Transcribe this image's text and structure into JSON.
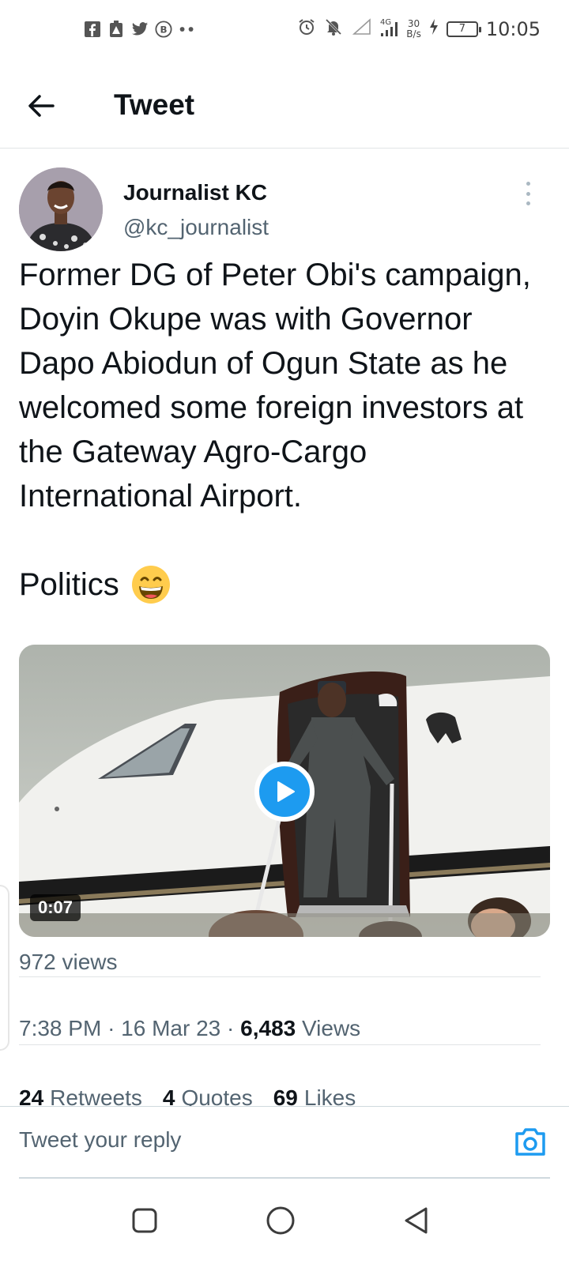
{
  "status_bar": {
    "time": "10:05",
    "net_speed_value": "30",
    "net_speed_unit": "B/s",
    "network": "4G",
    "battery": "7",
    "left_icons": [
      "facebook-icon",
      "alert-app-icon",
      "twitter-icon",
      "b-circle-icon",
      "more-notifications-icon"
    ],
    "right_icons": [
      "alarm-icon",
      "mute-icon",
      "signal-icon",
      "charging-icon"
    ]
  },
  "header": {
    "title": "Tweet",
    "back_icon": "arrow-left-icon"
  },
  "tweet": {
    "author_name": "Journalist KC",
    "author_handle": "@kc_journalist",
    "text": "Former DG of Peter Obi's campaign, Doyin Okupe was with Governor Dapo Abiodun of Ogun State as he welcomed some foreign investors at the Gateway Agro-Cargo International Airport.",
    "text_second": "Politics",
    "emoji": "grinning-face-icon",
    "video_duration": "0:07",
    "video_views": "972 views",
    "time": "7:38 PM",
    "date": "16 Mar 23",
    "separator": "·",
    "view_count": "6,483",
    "views_label": "Views",
    "retweets_count": "24",
    "retweets_label": "Retweets",
    "quotes_count": "4",
    "quotes_label": "Quotes",
    "likes_count": "69",
    "likes_label": "Likes"
  },
  "reply": {
    "placeholder": "Tweet your reply",
    "camera_icon": "camera-icon"
  },
  "colors": {
    "accent": "#1d9bf0",
    "text_primary": "#0f1419",
    "text_secondary": "#536471",
    "divider": "#e1e4e6"
  },
  "navigation": {
    "icons": [
      "recent-apps-icon",
      "home-circle-icon",
      "back-triangle-icon"
    ]
  }
}
